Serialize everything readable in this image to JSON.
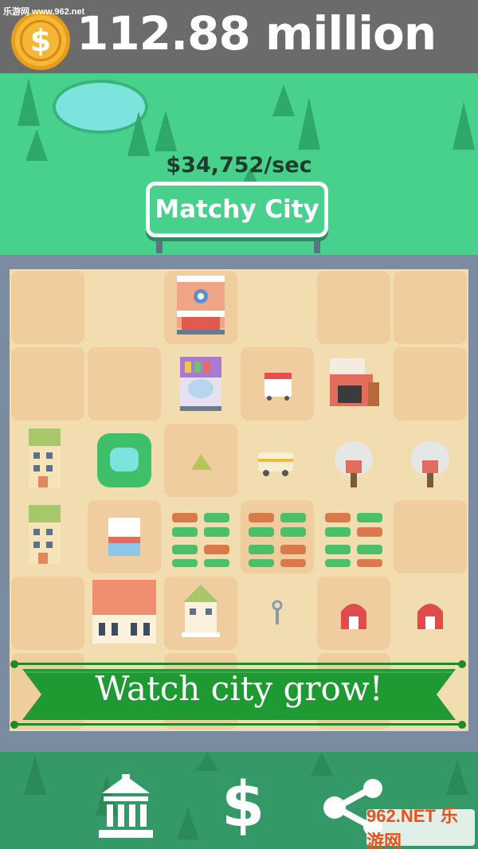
{
  "watermark": "乐游网 www.962.net",
  "hud": {
    "currency_icon": "dollar-coin-icon",
    "coin_symbol": "$",
    "money": "112.88 million",
    "rate": "$34,752/sec"
  },
  "city": {
    "name": "Matchy City"
  },
  "board": {
    "rows": [
      [
        "empty",
        "empty",
        "movie-theater",
        "empty",
        "empty",
        "empty"
      ],
      [
        "empty",
        "empty",
        "market-hall",
        "food-cart",
        "lumber-mill",
        "empty"
      ],
      [
        "apartment",
        "park",
        "tent",
        "camper-van",
        "mine",
        "mine"
      ],
      [
        "apartment",
        "shop",
        "crop-field",
        "crop-field",
        "crop-field",
        "empty"
      ],
      [
        "empty",
        "town-hall",
        "house",
        "key",
        "barn",
        "barn"
      ]
    ]
  },
  "banner": {
    "text": "Watch city grow!"
  },
  "toolbar": {
    "items": [
      {
        "name": "bank-icon"
      },
      {
        "name": "dollar-icon",
        "symbol": "$"
      },
      {
        "name": "share-icon"
      }
    ]
  },
  "logo": {
    "text": "962.NET 乐游网"
  },
  "colors": {
    "topbar": "#6b6b6b",
    "grass": "#48d08d",
    "board_frame": "#7b8ba1",
    "banner": "#1f9a33",
    "bottombar": "#349966"
  }
}
